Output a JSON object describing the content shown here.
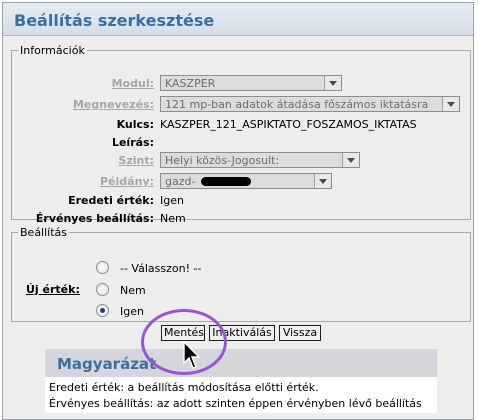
{
  "page": {
    "title": "Beállítás szerkesztése"
  },
  "info": {
    "legend": "Információk",
    "modul": {
      "label": "Modul:",
      "value": "KASZPER"
    },
    "megnevezes": {
      "label": "Megnevezés:",
      "value": "121 mp-ban adatok átadása főszámos iktatásra"
    },
    "kulcs": {
      "label": "Kulcs:",
      "value": "KASZPER_121_ASPIKTATO_FOSZAMOS_IKTATAS"
    },
    "leiras": {
      "label": "Leírás:",
      "value": ""
    },
    "szint": {
      "label": "Szint:",
      "value": "Helyi közös-Jogosult:"
    },
    "peldany": {
      "label": "Példány:",
      "value": "gazd-"
    },
    "eredeti": {
      "label": "Eredeti érték:",
      "value": "Igen"
    },
    "ervenyes": {
      "label": "Érvényes beállítás:",
      "value": "Nem"
    }
  },
  "settings": {
    "legend": "Beállítás",
    "new_value_label": "Új érték:",
    "options": [
      {
        "label": "-- Válasszon! --",
        "selected": false
      },
      {
        "label": "Nem",
        "selected": false
      },
      {
        "label": "Igen",
        "selected": true
      }
    ]
  },
  "buttons": {
    "save": "Mentés",
    "inactivate": "Inaktiválás",
    "back": "Vissza"
  },
  "explanation": {
    "title": "Magyarázat",
    "line1": "Eredeti érték: a beállítás módosítása előtti érték.",
    "line2": "Érvényes beállítás: az adott szinten éppen érvényben lévő beállítás"
  },
  "colors": {
    "title": "#3c6fa1",
    "highlight": "#9b55d4",
    "disabled_label": "#a6a6a6"
  }
}
